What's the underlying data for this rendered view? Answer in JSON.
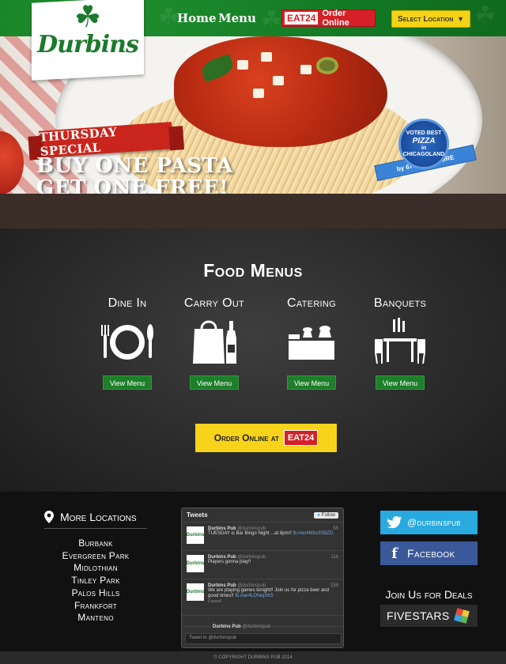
{
  "header": {
    "brand": "Durbins",
    "nav": {
      "home": "Home",
      "menu": "Menu"
    },
    "eat24": {
      "logo": "EAT24",
      "label": "Order Online"
    },
    "select_location": "Select Location"
  },
  "hero": {
    "banner": "THURSDAY SPECIAL",
    "headline_line1": "BUY ONE PASTA",
    "headline_line2": "GET ONE FREE!",
    "badge_line1": "VOTED BEST",
    "badge_line2": "PIZZA",
    "badge_line3": "in",
    "badge_line4": "CHICAGOLAND",
    "ribbon": "by 670 THE SCORE"
  },
  "menus": {
    "title": "Food Menus",
    "items": [
      {
        "label": "Dine In",
        "button": "View Menu"
      },
      {
        "label": "Carry Out",
        "button": "View Menu"
      },
      {
        "label": "Catering",
        "button": "View Menu"
      },
      {
        "label": "Banquets",
        "button": "View Menu"
      }
    ],
    "order_online": {
      "label": "Order Online at",
      "logo": "EAT24"
    }
  },
  "locations": {
    "title": "More Locations",
    "items": [
      "Burbank",
      "Evergreen Park",
      "Midlothian",
      "Tinley Park",
      "Palos Hills",
      "Frankfort",
      "Manteno"
    ]
  },
  "tweets": {
    "title": "Tweets",
    "follow": "Follow",
    "items": [
      {
        "name": "Durbins Pub",
        "handle": "@durbinspub",
        "time": "5h",
        "text": "TUESDAY is Bar Bingo Night ...at 8pm!!",
        "link": "fb.me/4Mbx3SBZD",
        "expand": ""
      },
      {
        "name": "Durbins Pub",
        "handle": "@durbinspub",
        "time": "11h",
        "text": "Players gonna play!!",
        "link": "",
        "expand": ""
      },
      {
        "name": "Durbins Pub",
        "handle": "@durbinspub",
        "time": "15h",
        "text": "We are playing games tonight!! Join us for pizza beer and good times!!",
        "link": "fb.me/4LDfwqSK5",
        "expand": "Expand"
      },
      {
        "name": "Durbins Pub",
        "handle": "@durbinspub",
        "time": "",
        "text": "",
        "link": "",
        "expand": ""
      }
    ],
    "tweet_to": "Tweet to @durbinspub"
  },
  "social": {
    "twitter": "@durbinspub",
    "facebook": "Facebook",
    "join_title": "Join Us for Deals",
    "fivestars": "FIVESTARS"
  },
  "footer": {
    "copyright": "© COPYRIGHT DURBINS PUB 2014"
  }
}
